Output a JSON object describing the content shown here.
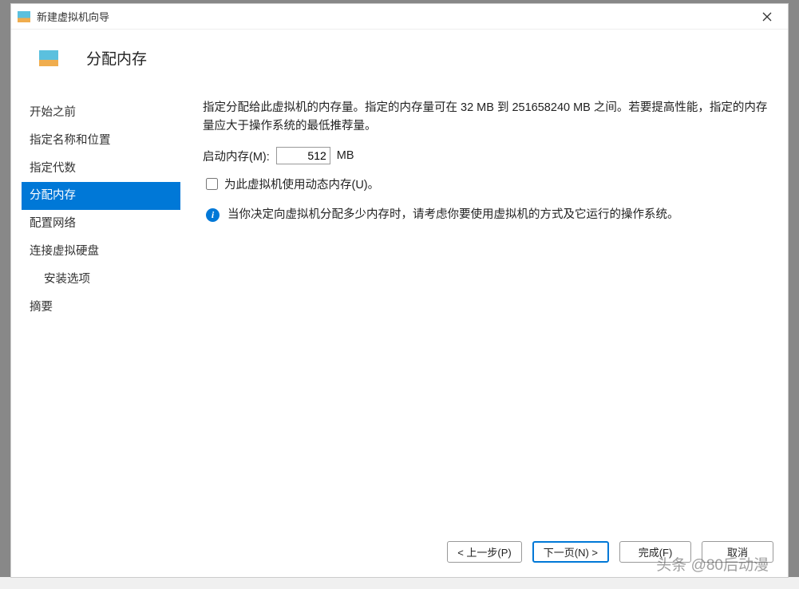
{
  "window": {
    "title": "新建虚拟机向导"
  },
  "header": {
    "title": "分配内存"
  },
  "sidebar": {
    "items": [
      {
        "label": "开始之前",
        "active": false
      },
      {
        "label": "指定名称和位置",
        "active": false
      },
      {
        "label": "指定代数",
        "active": false
      },
      {
        "label": "分配内存",
        "active": true
      },
      {
        "label": "配置网络",
        "active": false
      },
      {
        "label": "连接虚拟硬盘",
        "active": false
      },
      {
        "label": "安装选项",
        "active": false,
        "indent": true
      },
      {
        "label": "摘要",
        "active": false
      }
    ]
  },
  "main": {
    "description": "指定分配给此虚拟机的内存量。指定的内存量可在 32 MB 到 251658240 MB 之间。若要提高性能，指定的内存量应大于操作系统的最低推荐量。",
    "memory_label": "启动内存(M):",
    "memory_value": "512",
    "memory_unit": "MB",
    "checkbox_label": "为此虚拟机使用动态内存(U)。",
    "info_text": "当你决定向虚拟机分配多少内存时，请考虑你要使用虚拟机的方式及它运行的操作系统。"
  },
  "buttons": {
    "prev": "< 上一步(P)",
    "next": "下一页(N) >",
    "finish": "完成(F)",
    "cancel": "取消"
  },
  "watermark": "头条 @80后动漫"
}
